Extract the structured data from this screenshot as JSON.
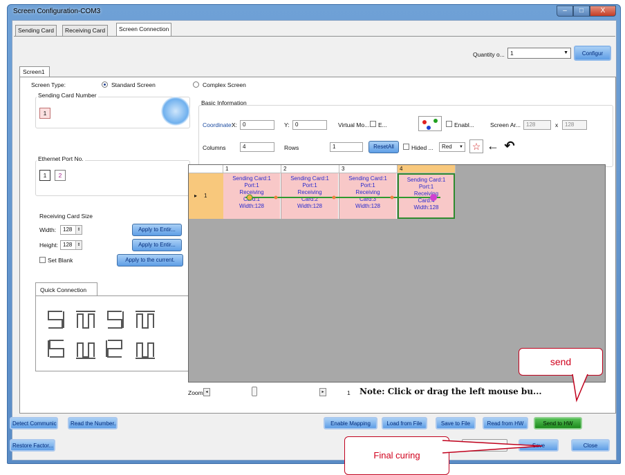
{
  "window": {
    "title": "Screen Configuration-COM3",
    "controls": {
      "minimize": "–",
      "maximize": "□",
      "close": "X"
    }
  },
  "top_tabs": [
    {
      "label": "Sending Card"
    },
    {
      "label": "Receiving Card"
    },
    {
      "label": "Screen Connection"
    }
  ],
  "quantity": {
    "label": "Quantity o...",
    "value": "1"
  },
  "configure_button": "Configur",
  "screen_tab": "Screen1",
  "screen_type": {
    "label": "Screen Type:",
    "standard": "Standard Screen",
    "complex": "Complex Screen"
  },
  "sending_card_number": {
    "title": "Sending Card Number",
    "value": "1"
  },
  "ethernet_port": {
    "title": "Ethernet Port No.",
    "ports": [
      "1",
      "2"
    ]
  },
  "receiving_card_size": {
    "title": "Receiving Card Size",
    "width_label": "Width:",
    "width_value": "128",
    "height_label": "Height:",
    "height_value": "128",
    "apply_width": "Apply to Entir...",
    "apply_height": "Apply to Entir...",
    "set_blank": "Set Blank",
    "apply_current": "Apply to the current."
  },
  "quick_connection": {
    "title": "Quick Connection"
  },
  "basic_info": {
    "title": "Basic Information",
    "coordinate_label": "Coordinate:",
    "x_label": "X:",
    "x_value": "0",
    "y_label": "Y:",
    "y_value": "0",
    "virtual_mode": "Virtual Mo...",
    "e_label": "E...",
    "enable_label": "Enabl...",
    "screen_area_label": "Screen Ar...",
    "screen_w": "128",
    "x_sep": "x",
    "screen_h": "128",
    "columns_label": "Columns",
    "columns_value": "4",
    "rows_label": "Rows",
    "rows_value": "1",
    "reset_all": "ResetAll",
    "hided": "Hided ...",
    "color_value": "Red"
  },
  "grid": {
    "columns": [
      "1",
      "2",
      "3",
      "4"
    ],
    "row_label": "1",
    "cells": [
      {
        "l1": "Sending Card:1",
        "l2": "Port:1",
        "l3": "Receiving",
        "l4": "Card:1",
        "l5": "Width:128"
      },
      {
        "l1": "Sending Card:1",
        "l2": "Port:1",
        "l3": "Receiving",
        "l4": "Card:2",
        "l5": "Width:128"
      },
      {
        "l1": "Sending Card:1",
        "l2": "Port:1",
        "l3": "Receiving",
        "l4": "Card:3",
        "l5": "Width:128"
      },
      {
        "l1": "Sending Card:1",
        "l2": "Port:1",
        "l3": "Receiving",
        "l4": "Card:4",
        "l5": "Width:128"
      }
    ]
  },
  "zoom": {
    "label": "Zoom:",
    "value": "1",
    "note": "Note: Click or drag the left mouse bu...",
    "note_tail": "..."
  },
  "bottom_row1": {
    "detect": "Detect Communic...",
    "read_number": "Read the Number...",
    "enable_mapping": "Enable Mapping",
    "load_file": "Load from File",
    "save_file": "Save to File",
    "read_hw": "Read from HW",
    "send_hw": "Send to HW"
  },
  "bottom_row2": {
    "restore": "Restore Factor...",
    "save": "Save",
    "close": "Close"
  },
  "callouts": {
    "send": "send",
    "final": "Final curing"
  }
}
